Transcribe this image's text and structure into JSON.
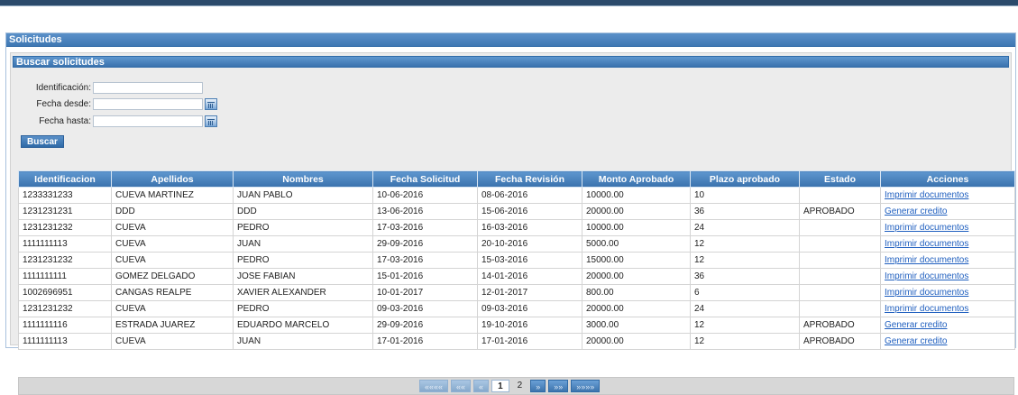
{
  "panel": {
    "title": "Solicitudes"
  },
  "search": {
    "title": "Buscar solicitudes",
    "fields": {
      "identificacion": {
        "label": "Identificación:",
        "value": ""
      },
      "fecha_desde": {
        "label": "Fecha desde:",
        "value": ""
      },
      "fecha_hasta": {
        "label": "Fecha hasta:",
        "value": ""
      }
    },
    "button_label": "Buscar"
  },
  "table": {
    "columns": [
      "Identificacion",
      "Apellidos",
      "Nombres",
      "Fecha Solicitud",
      "Fecha Revisión",
      "Monto Aprobado",
      "Plazo aprobado",
      "Estado",
      "Acciones"
    ],
    "rows": [
      [
        "1233331233",
        "CUEVA MARTINEZ",
        "JUAN PABLO",
        "10-06-2016",
        "08-06-2016",
        "10000.00",
        "10",
        "",
        "Imprimir documentos"
      ],
      [
        "1231231231",
        "DDD",
        "DDD",
        "13-06-2016",
        "15-06-2016",
        "20000.00",
        "36",
        "APROBADO",
        "Generar credito"
      ],
      [
        "1231231232",
        "CUEVA",
        "PEDRO",
        "17-03-2016",
        "16-03-2016",
        "10000.00",
        "24",
        "",
        "Imprimir documentos"
      ],
      [
        "1111111113",
        "CUEVA",
        "JUAN",
        "29-09-2016",
        "20-10-2016",
        "5000.00",
        "12",
        "",
        "Imprimir documentos"
      ],
      [
        "1231231232",
        "CUEVA",
        "PEDRO",
        "17-03-2016",
        "15-03-2016",
        "15000.00",
        "12",
        "",
        "Imprimir documentos"
      ],
      [
        "1111111111",
        "GOMEZ DELGADO",
        "JOSE FABIAN",
        "15-01-2016",
        "14-01-2016",
        "20000.00",
        "36",
        "",
        "Imprimir documentos"
      ],
      [
        "1002696951",
        "CANGAS REALPE",
        "XAVIER ALEXANDER",
        "10-01-2017",
        "12-01-2017",
        "800.00",
        "6",
        "",
        "Imprimir documentos"
      ],
      [
        "1231231232",
        "CUEVA",
        "PEDRO",
        "09-03-2016",
        "09-03-2016",
        "20000.00",
        "24",
        "",
        "Imprimir documentos"
      ],
      [
        "1111111116",
        "ESTRADA JUAREZ",
        "EDUARDO MARCELO",
        "29-09-2016",
        "19-10-2016",
        "3000.00",
        "12",
        "APROBADO",
        "Generar credito"
      ],
      [
        "1111111113",
        "CUEVA",
        "JUAN",
        "17-01-2016",
        "17-01-2016",
        "20000.00",
        "12",
        "APROBADO",
        "Generar credito"
      ]
    ]
  },
  "pager": {
    "first": "««««",
    "prev_page": "««",
    "prev": "«",
    "pages": [
      "1",
      "2"
    ],
    "current": "1",
    "next": "»",
    "next_page": "»»",
    "last": "»»»»"
  }
}
